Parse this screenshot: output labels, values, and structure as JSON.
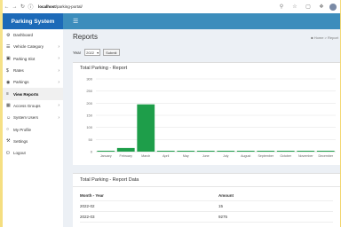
{
  "browser": {
    "url_host": "localhost",
    "url_path": "/parking-portal/",
    "nav_icons": [
      "back-icon",
      "forward-icon",
      "reload-icon"
    ]
  },
  "app": {
    "title": "Parking System"
  },
  "sidebar": {
    "items": [
      {
        "label": "Dashboard",
        "icon": "⚙",
        "has_chevron": false
      },
      {
        "label": "Vehicle Category",
        "icon": "☰",
        "has_chevron": true
      },
      {
        "label": "Parking Slot",
        "icon": "▣",
        "has_chevron": true
      },
      {
        "label": "Rates",
        "icon": "$",
        "has_chevron": true
      },
      {
        "label": "Parkings",
        "icon": "◉",
        "has_chevron": true
      },
      {
        "label": "View Reports",
        "icon": "≡",
        "has_chevron": false,
        "active": true
      },
      {
        "label": "Access Groups",
        "icon": "▦",
        "has_chevron": true
      },
      {
        "label": "System Users",
        "icon": "☺",
        "has_chevron": true
      },
      {
        "label": "My Profile",
        "icon": "○",
        "has_chevron": false
      },
      {
        "label": "Settings",
        "icon": "⚒",
        "has_chevron": false
      },
      {
        "label": "Logout",
        "icon": "⏻",
        "has_chevron": false
      }
    ]
  },
  "page": {
    "title": "Reports",
    "breadcrumb": "Home > Report"
  },
  "filter": {
    "label": "Year",
    "year_value": "2022",
    "submit_label": "Submit"
  },
  "chart_panel": {
    "title": "Total Parking - Report"
  },
  "chart_data": {
    "type": "bar",
    "title": "Total Parking - Report",
    "categories": [
      "January",
      "February",
      "March",
      "April",
      "May",
      "June",
      "July",
      "August",
      "September",
      "October",
      "November",
      "December"
    ],
    "values": [
      0,
      15,
      195,
      0,
      0,
      0,
      0,
      0,
      0,
      0,
      0,
      0
    ],
    "yticks": [
      0,
      50,
      100,
      150,
      200,
      250,
      300
    ],
    "ylim": [
      0,
      300
    ],
    "grid": true,
    "bar_color": "#1e9e4a"
  },
  "table_panel": {
    "title": "Total Parking - Report Data",
    "headers": [
      "Month - Year",
      "Amount"
    ],
    "rows": [
      [
        "2022-02",
        "15"
      ],
      [
        "2022-03",
        "9275"
      ]
    ]
  },
  "colors": {
    "brand": "#1d6ab8",
    "topbar": "#3c8dbc",
    "bar": "#1e9e4a"
  }
}
